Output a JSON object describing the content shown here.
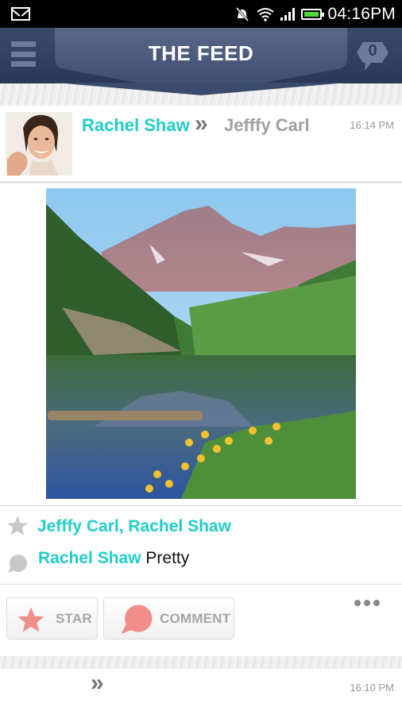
{
  "status_bar": {
    "time": "04:16PM",
    "icons": [
      "gmail-icon",
      "mute-icon",
      "wifi-icon",
      "signal-icon",
      "battery-icon"
    ]
  },
  "header": {
    "title": "THE FEED",
    "menu_icon": "hamburger-menu-icon",
    "notification_count": "0"
  },
  "colors": {
    "accent": "#21cdc9",
    "header_bg": "#2b3758",
    "button_icon": "#f08e8a"
  },
  "posts": [
    {
      "author": "Rachel Shaw",
      "recipient": "Jefffy Carl",
      "time": "16:14 PM",
      "photo_alt": "Mountain lake landscape",
      "starred_by": "Jefffy Carl, Rachel Shaw",
      "comments": [
        {
          "author": "Rachel Shaw",
          "text": "Pretty"
        }
      ],
      "actions": {
        "star_label": "STAR",
        "comment_label": "COMMENT"
      }
    },
    {
      "author": "",
      "recipient": "",
      "time": "16:10 PM"
    }
  ]
}
